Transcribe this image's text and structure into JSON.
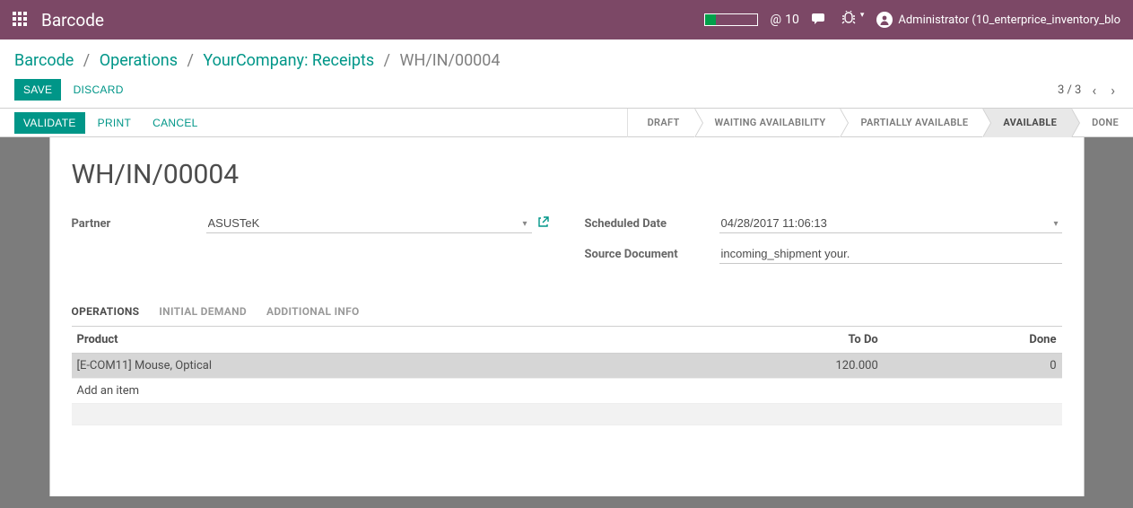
{
  "navbar": {
    "brand": "Barcode",
    "msg_count": "10",
    "user": "Administrator (10_enterprice_inventory_blo"
  },
  "breadcrumb": {
    "items": [
      "Barcode",
      "Operations",
      "YourCompany: Receipts"
    ],
    "current": "WH/IN/00004"
  },
  "buttons": {
    "save": "Save",
    "discard": "Discard",
    "validate": "Validate",
    "print": "Print",
    "cancel": "Cancel"
  },
  "pager": {
    "text": "3 / 3"
  },
  "status_steps": [
    "Draft",
    "Waiting Availability",
    "Partially Available",
    "Available",
    "Done"
  ],
  "record": {
    "title": "WH/IN/00004",
    "fields": {
      "partner_label": "Partner",
      "partner_value": "ASUSTeK",
      "scheduled_label": "Scheduled Date",
      "scheduled_value": "04/28/2017 11:06:13",
      "source_label": "Source Document",
      "source_value": "incoming_shipment your."
    }
  },
  "tabs": [
    "Operations",
    "Initial Demand",
    "Additional Info"
  ],
  "table": {
    "headers": {
      "product": "Product",
      "todo": "To Do",
      "done": "Done"
    },
    "rows": [
      {
        "product": "[E-COM11] Mouse, Optical",
        "todo": "120.000",
        "done": "0"
      }
    ],
    "add": "Add an item"
  }
}
